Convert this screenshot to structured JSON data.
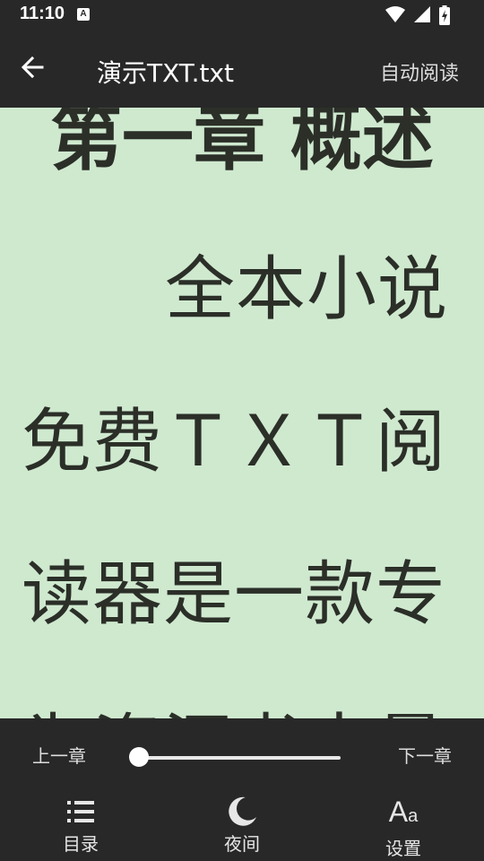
{
  "status_bar": {
    "time": "11:10",
    "notification_letter": "A"
  },
  "app_bar": {
    "title": "演示TXT.txt",
    "auto_read_label": "自动阅读"
  },
  "reader": {
    "chapter_title": "第一章 概述",
    "lines": [
      "全本小说",
      "免费ＴＸＴ阅",
      "读器是一款专",
      "为资深书虫量"
    ],
    "background_color": "#cfe9cf",
    "text_color": "#2b2f28"
  },
  "controls": {
    "prev_chapter_label": "上一章",
    "next_chapter_label": "下一章",
    "chapter_progress": 0
  },
  "bottom_nav": {
    "toc_label": "目录",
    "night_label": "夜间",
    "settings_label": "设置"
  },
  "icons": {
    "back": "arrow-back-icon",
    "toc": "list-icon",
    "night": "moon-icon",
    "settings": "font-size-icon"
  }
}
